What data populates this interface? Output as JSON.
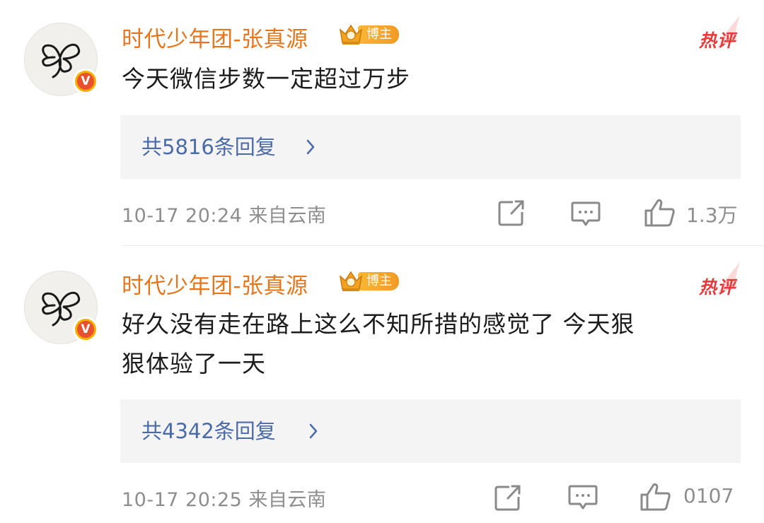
{
  "comments": [
    {
      "username": "时代少年团-张真源",
      "badge": "博主",
      "hot_label": "热评",
      "text": "今天微信步数一定超过万步",
      "replies": "共5816条回复",
      "meta": "10-17 20:24  来自云南",
      "likes": "1.3万"
    },
    {
      "username": "时代少年团-张真源",
      "badge": "博主",
      "hot_label": "热评",
      "text_line1": "好久没有走在路上这么不知所措的感觉了 今天狠",
      "text_line2": "狠体验了一天",
      "replies": "共4342条回复",
      "meta": "10-17 20:25  来自云南",
      "likes": "0107"
    }
  ],
  "colors": {
    "username": "#e7761b",
    "link": "#4a6aa8",
    "hot": "#e83a3a",
    "meta": "#8e8e8e",
    "reply_bg": "#f4f4f4"
  },
  "icons": [
    "verified-v-icon",
    "crown-badge-icon",
    "chevron-right-icon",
    "share-icon",
    "comment-icon",
    "like-icon"
  ]
}
